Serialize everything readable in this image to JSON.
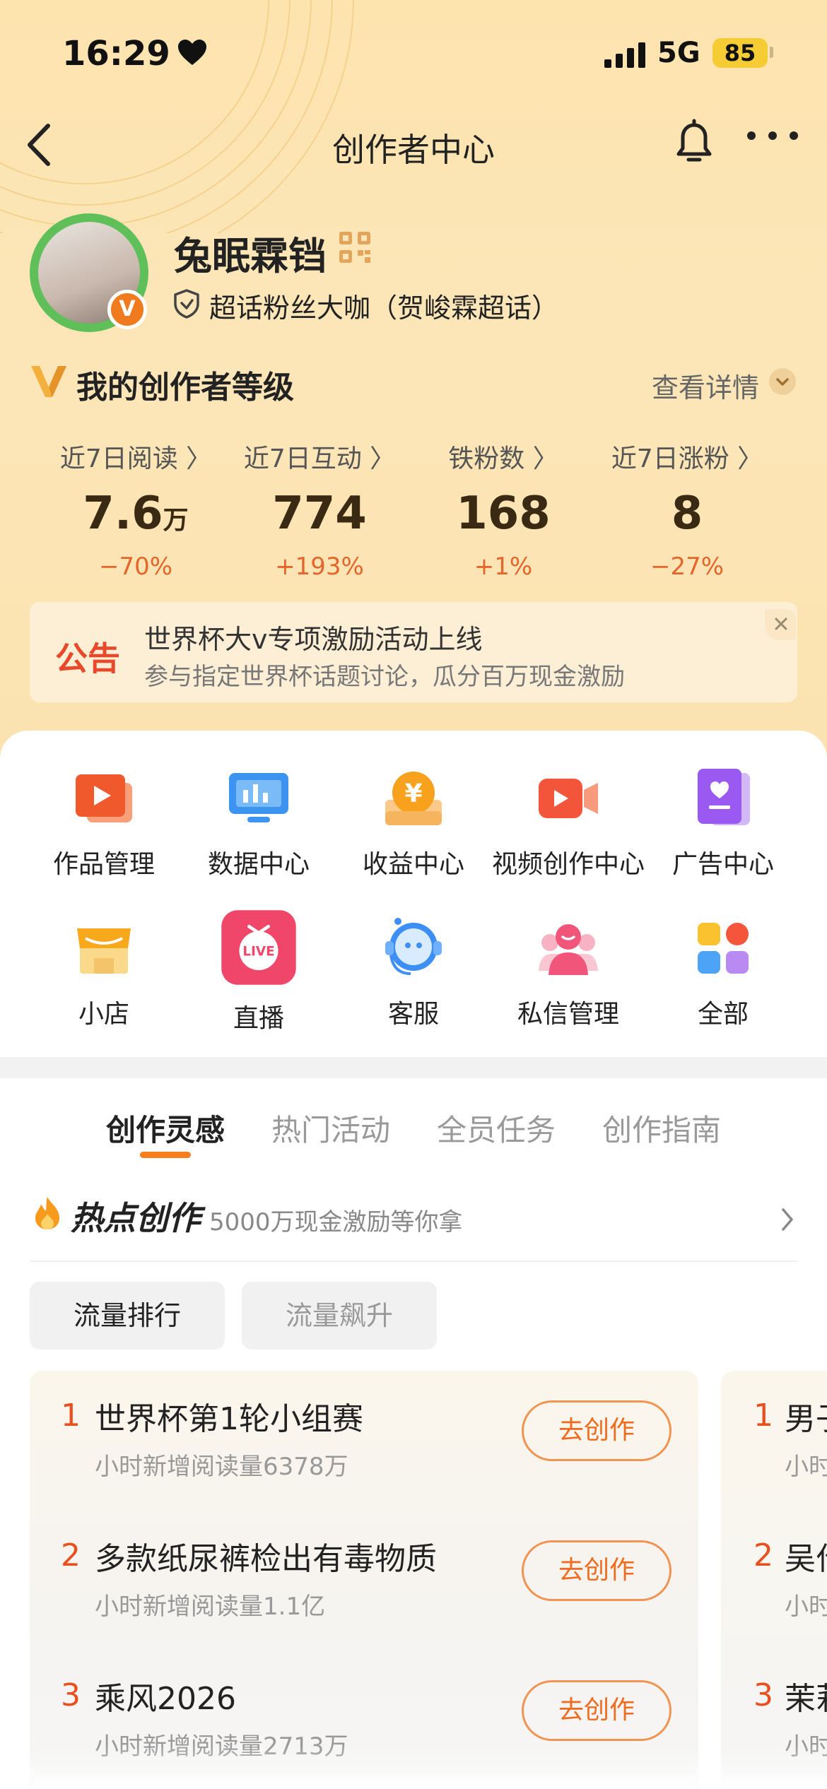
{
  "status_bar": {
    "time": "16:29",
    "network": "5G",
    "battery": "85"
  },
  "nav": {
    "title": "创作者中心"
  },
  "profile": {
    "username": "兔眠霖铛",
    "fan_title": "超话粉丝大咖（贺峻霖超话）"
  },
  "level": {
    "title": "我的创作者等级",
    "detail_label": "查看详情"
  },
  "stats": [
    {
      "label": "近7日阅读 〉",
      "value": "7.6",
      "unit": "万",
      "change": "−70%"
    },
    {
      "label": "近7日互动 〉",
      "value": "774",
      "unit": "",
      "change": "+193%"
    },
    {
      "label": "铁粉数 〉",
      "value": "168",
      "unit": "",
      "change": "+1%"
    },
    {
      "label": "近7日涨粉 〉",
      "value": "8",
      "unit": "",
      "change": "−27%"
    }
  ],
  "notice": {
    "tag": "公告",
    "title": "世界杯大v专项激励活动上线",
    "subtitle": "参与指定世界杯话题讨论，瓜分百万现金激励"
  },
  "tools": [
    {
      "label": "作品管理",
      "icon": "works-icon"
    },
    {
      "label": "数据中心",
      "icon": "data-icon"
    },
    {
      "label": "收益中心",
      "icon": "income-icon"
    },
    {
      "label": "视频创作中心",
      "icon": "video-icon"
    },
    {
      "label": "广告中心",
      "icon": "ad-icon"
    },
    {
      "label": "小店",
      "icon": "shop-icon"
    },
    {
      "label": "直播",
      "icon": "live-icon"
    },
    {
      "label": "客服",
      "icon": "service-icon"
    },
    {
      "label": "私信管理",
      "icon": "message-icon"
    },
    {
      "label": "全部",
      "icon": "all-icon"
    }
  ],
  "tabs": [
    "创作灵感",
    "热门活动",
    "全员任务",
    "创作指南"
  ],
  "hot": {
    "title": "热点创作",
    "subtitle": "5000万现金激励等你拿"
  },
  "filters": [
    "流量排行",
    "流量飙升"
  ],
  "ranking": [
    {
      "rank": "1",
      "title": "世界杯第1轮小组赛",
      "sub": "小时新增阅读量6378万",
      "button": "去创作"
    },
    {
      "rank": "2",
      "title": "多款纸尿裤检出有毒物质",
      "sub": "小时新增阅读量1.1亿",
      "button": "去创作"
    },
    {
      "rank": "3",
      "title": "乘风2026",
      "sub": "小时新增阅读量2713万",
      "button": "去创作"
    }
  ],
  "ranking_peek": [
    {
      "rank": "1",
      "title": "男子",
      "sub": "小时"
    },
    {
      "rank": "2",
      "title": "吴什",
      "sub": "小时"
    },
    {
      "rank": "3",
      "title": "茉莉",
      "sub": "小时"
    }
  ],
  "colors": {
    "accent": "#f67e1c",
    "header_bg": "#fde3ae",
    "change_text": "#e5662a"
  }
}
